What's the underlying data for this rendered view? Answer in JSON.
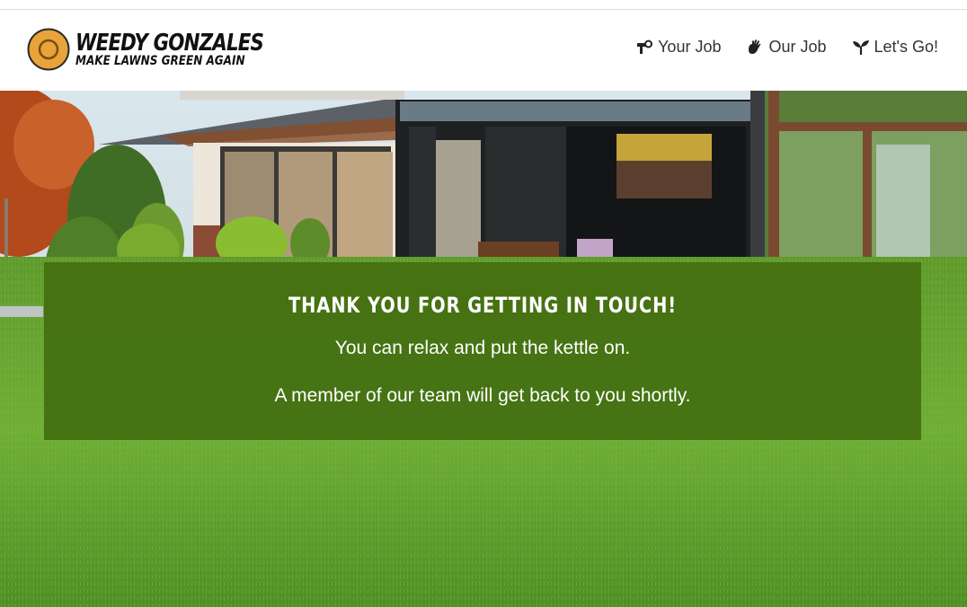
{
  "brand": {
    "title": "WEEDY GONZALES",
    "tagline": "MAKE LAWNS GREEN AGAIN",
    "logo_color": "#e8a33a"
  },
  "nav": {
    "items": [
      {
        "label": "Your Job",
        "icon": "watering-can-icon"
      },
      {
        "label": "Our Job",
        "icon": "hand-icon"
      },
      {
        "label": "Let's Go!",
        "icon": "sprout-icon"
      }
    ]
  },
  "message": {
    "heading": "THANK YOU FOR GETTING IN TOUCH!",
    "line1": "You can relax and put the kettle on.",
    "line2": "A member of our team will get back to you shortly.",
    "panel_color": "#457012"
  }
}
